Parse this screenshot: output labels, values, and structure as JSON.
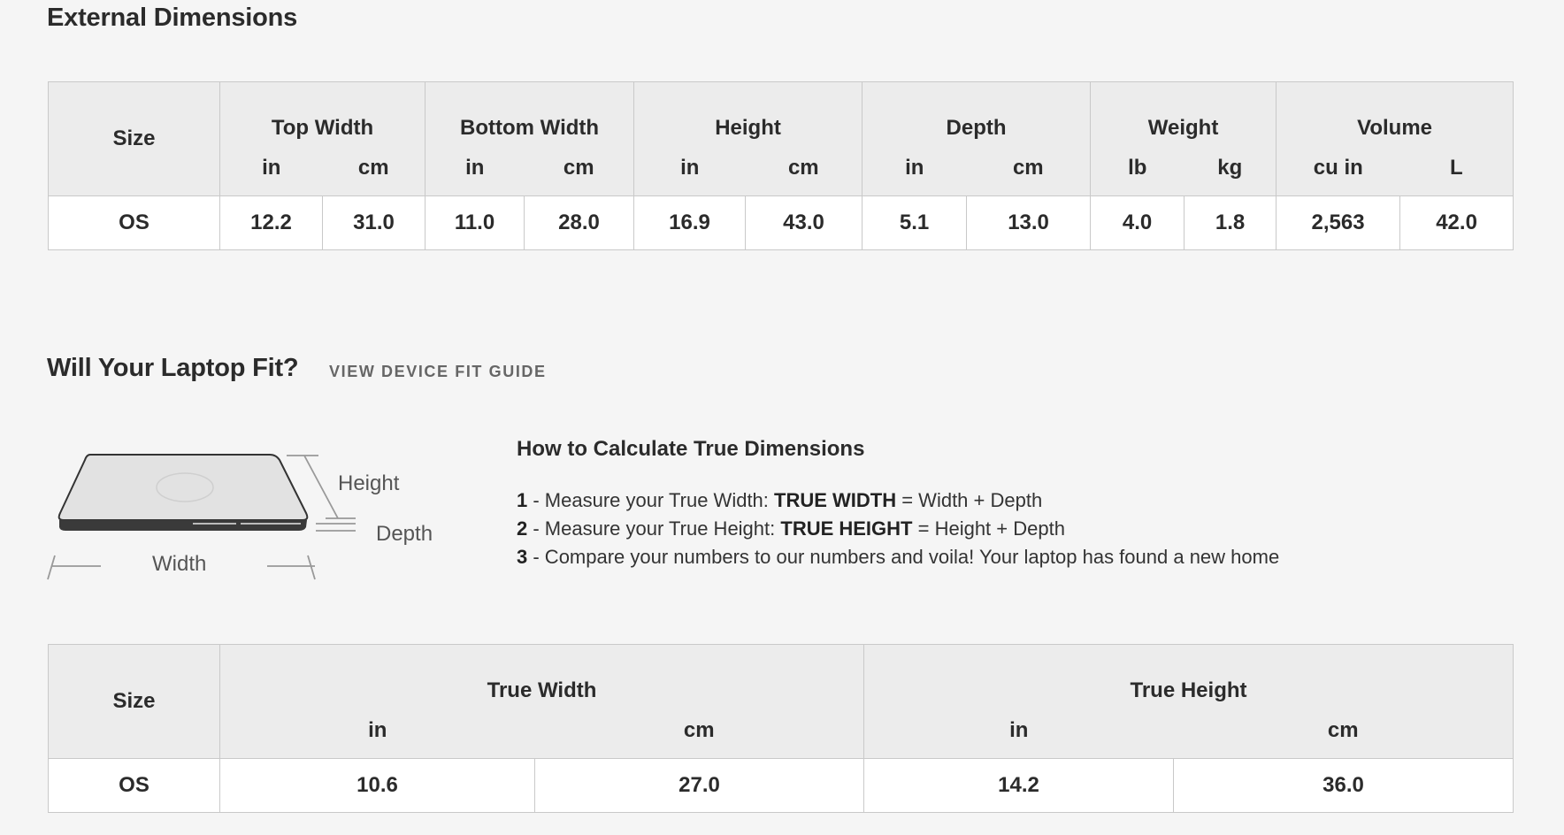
{
  "external": {
    "title": "External Dimensions",
    "size_header": "Size",
    "groups": [
      {
        "label": "Top Width",
        "units": [
          "in",
          "cm"
        ]
      },
      {
        "label": "Bottom Width",
        "units": [
          "in",
          "cm"
        ]
      },
      {
        "label": "Height",
        "units": [
          "in",
          "cm"
        ]
      },
      {
        "label": "Depth",
        "units": [
          "in",
          "cm"
        ]
      },
      {
        "label": "Weight",
        "units": [
          "lb",
          "kg"
        ]
      },
      {
        "label": "Volume",
        "units": [
          "cu in",
          "L"
        ]
      }
    ],
    "row": {
      "size": "OS",
      "values": [
        "12.2",
        "31.0",
        "11.0",
        "28.0",
        "16.9",
        "43.0",
        "5.1",
        "13.0",
        "4.0",
        "1.8",
        "2,563",
        "42.0"
      ]
    }
  },
  "fit": {
    "title": "Will Your Laptop Fit?",
    "link_label": "VIEW DEVICE FIT GUIDE",
    "diagram": {
      "height_label": "Height",
      "depth_label": "Depth",
      "width_label": "Width"
    },
    "instructions": {
      "title": "How to Calculate True Dimensions",
      "steps": [
        {
          "num": "1",
          "text_a": " - Measure your True Width: ",
          "bold": "TRUE WIDTH",
          "text_b": " = Width + Depth"
        },
        {
          "num": "2",
          "text_a": " - Measure your True Height: ",
          "bold": "TRUE HEIGHT",
          "text_b": " = Height + Depth"
        },
        {
          "num": "3",
          "text_a": " - Compare your numbers to our numbers and voila! Your laptop has found a new home",
          "bold": "",
          "text_b": ""
        }
      ]
    }
  },
  "true_dims": {
    "size_header": "Size",
    "groups": [
      {
        "label": "True Width",
        "units": [
          "in",
          "cm"
        ]
      },
      {
        "label": "True Height",
        "units": [
          "in",
          "cm"
        ]
      }
    ],
    "row": {
      "size": "OS",
      "values": [
        "10.6",
        "27.0",
        "14.2",
        "36.0"
      ]
    }
  }
}
